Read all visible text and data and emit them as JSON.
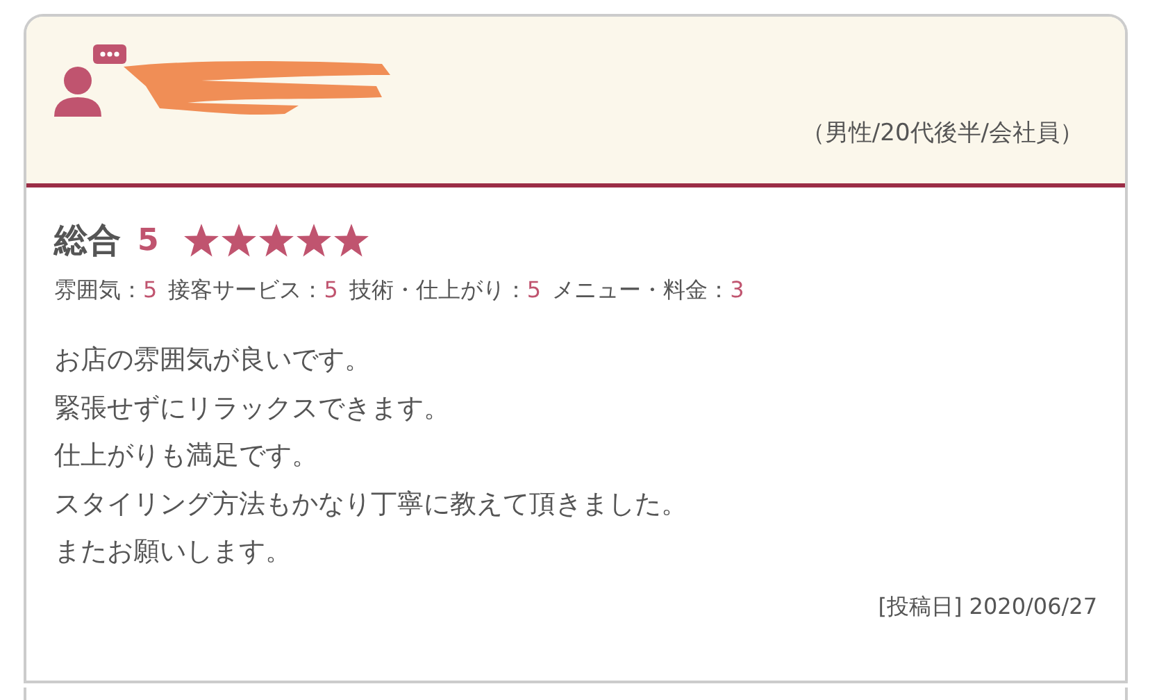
{
  "review": {
    "reviewer_profile": "（男性/20代後半/会社員）",
    "overall": {
      "label": "総合",
      "score": "5",
      "stars": 5
    },
    "ratings": [
      {
        "label": "雰囲気：",
        "value": "5"
      },
      {
        "label": "接客サービス：",
        "value": "5"
      },
      {
        "label": "技術・仕上がり：",
        "value": "5"
      },
      {
        "label": "メニュー・料金：",
        "value": "3"
      }
    ],
    "comment": [
      "お店の雰囲気が良いです。",
      "緊張せずにリラックスできます。",
      "仕上がりも満足です。",
      "スタイリング方法もかなり丁寧に教えて頂きました。",
      "またお願いします。"
    ],
    "posted_date": "[投稿日] 2020/06/27"
  }
}
